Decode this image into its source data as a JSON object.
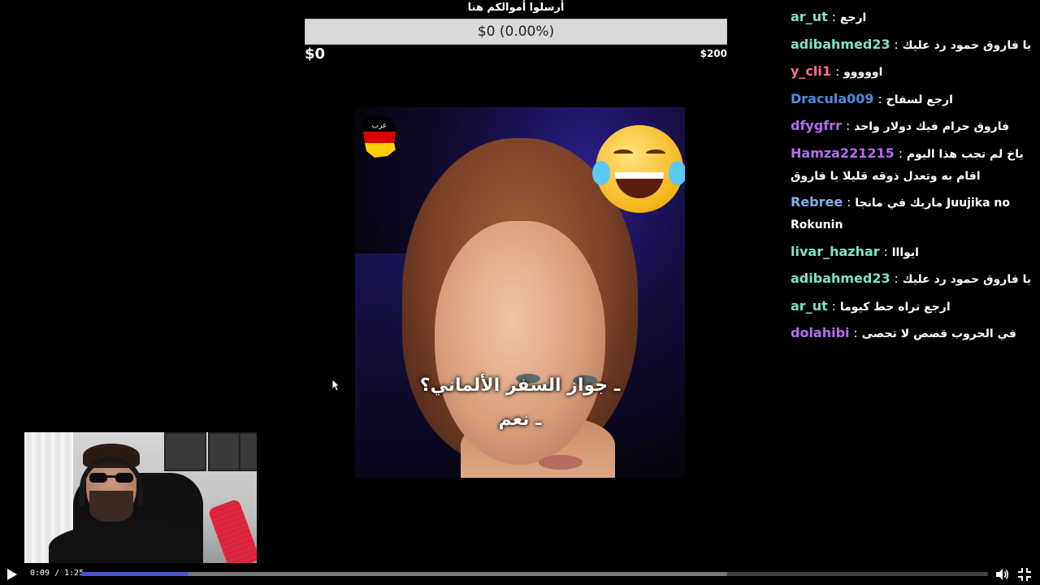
{
  "goal": {
    "title": "أرسلوا أموالكم هنا",
    "progress_text": "$0 (0.00%)",
    "progress_fraction": 0,
    "min_label": "$0",
    "max_label": "$200",
    "fill_color": "#4caf50"
  },
  "video": {
    "subtitle_line1": "ـ جواز السفر الألماني؟",
    "subtitle_line2": "ـ نعم",
    "channel_logo_icon": "germany-map-logo",
    "emoji_icon": "laughing-tears-emoji"
  },
  "chat": {
    "messages": [
      {
        "user": "ar_ut",
        "color": "#7fe3c4",
        "text": "ارجع"
      },
      {
        "user": "adibahmed23",
        "color": "#7fe3c4",
        "text": "يا فاروق حمود رد عليك"
      },
      {
        "user": "y_cli1",
        "color": "#ff6f91",
        "text": "اووووو"
      },
      {
        "user": "Dracula009",
        "color": "#4a8fe0",
        "text": "ارجع لسفاح"
      },
      {
        "user": "dfygfrr",
        "color": "#b56cf0",
        "text": "فاروق حرام فيك دولار واحد"
      },
      {
        "user": "Hamza221215",
        "color": "#b56cf0",
        "text": "ياخ لم تجب هذا اليوم اقام به وتعدل ذوقه قليلا يا فاروق"
      },
      {
        "user": "Rebree",
        "color": "#89aee8",
        "text": "ماريك في مانجا Juujika no Rokunin"
      },
      {
        "user": "livar_hazhar",
        "color": "#7fe3c4",
        "text": "ايوااا"
      },
      {
        "user": "adibahmed23",
        "color": "#7fe3c4",
        "text": "يا فاروق حمود رد عليك"
      },
      {
        "user": "ar_ut",
        "color": "#7fe3c4",
        "text": "ارجع تراه حط كيوما"
      },
      {
        "user": "dolahibi",
        "color": "#b56cf0",
        "text": "في الحروب قصص لا تحصى"
      }
    ]
  },
  "player": {
    "time": "0:09 / 1:25",
    "played_fraction": 0.118,
    "buffered_fraction": 0.712,
    "played_color": "#4a53d8",
    "play_icon": "play-icon",
    "volume_icon": "volume-icon",
    "fullscreen_icon": "exit-fullscreen-icon"
  }
}
